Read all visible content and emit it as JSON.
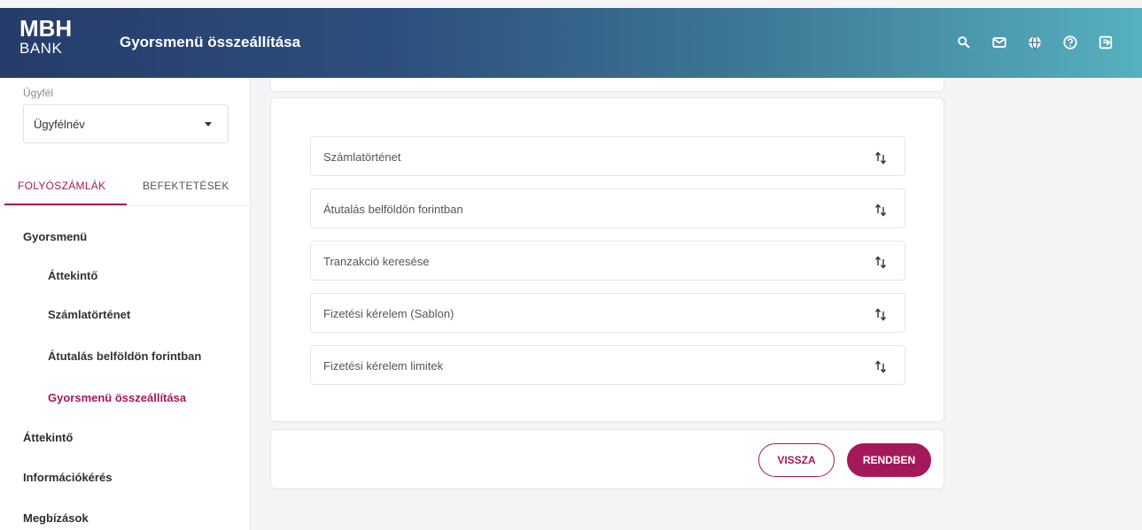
{
  "header": {
    "logo_top": "MBH",
    "logo_bottom": "BANK",
    "title": "Gyorsmenü összeállítása",
    "icons": [
      "search-icon",
      "mail-icon",
      "globe-icon",
      "help-icon",
      "logout-icon"
    ]
  },
  "sidebar": {
    "client_label": "Ügyfél",
    "client_value": "Ügyfélnév",
    "tabs": [
      {
        "label": "FOLYÓSZÁMLÁK",
        "active": true
      },
      {
        "label": "BEFEKTETÉSEK",
        "active": false
      }
    ],
    "section_quickmenu": "Gyorsmenü",
    "quickmenu_items": [
      {
        "label": "Áttekintő"
      },
      {
        "label": "Számlatörténet"
      },
      {
        "label": "Átutalás belföldön forintban"
      },
      {
        "label": "Gyorsmenü összeállítása",
        "active": true
      }
    ],
    "menu_items": [
      {
        "label": "Áttekintő"
      },
      {
        "label": "Információkérés"
      },
      {
        "label": "Megbízások"
      }
    ]
  },
  "main": {
    "rows": [
      {
        "label": "Számlatörténet"
      },
      {
        "label": "Átutalás belföldön forintban"
      },
      {
        "label": "Tranzakció keresése"
      },
      {
        "label": "Fizetési kérelem (Sablon)"
      },
      {
        "label": "Fizetési kérelem limitek"
      }
    ]
  },
  "footer": {
    "back_label": "VISSZA",
    "ok_label": "RENDBEN"
  },
  "colors": {
    "accent": "#a3195b",
    "header_start": "#263c6a",
    "header_end": "#56b0bf"
  }
}
